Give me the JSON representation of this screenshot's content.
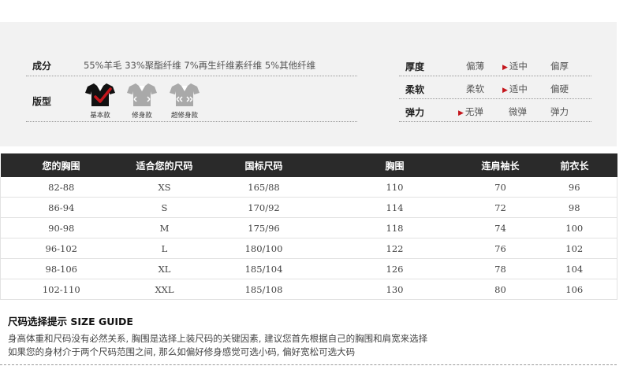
{
  "attributes": {
    "composition_label": "成分",
    "composition_value": "55%羊毛 33%聚酯纤维 7%再生纤维素纤维 5%其他纤维",
    "fit_label": "版型",
    "fits": [
      {
        "label": "基本款",
        "selected": true
      },
      {
        "label": "修身款",
        "selected": false
      },
      {
        "label": "超修身款",
        "selected": false
      }
    ],
    "thickness": {
      "label": "厚度",
      "options": [
        "偏薄",
        "适中",
        "偏厚"
      ],
      "selected": "适中"
    },
    "softness": {
      "label": "柔软",
      "options": [
        "柔软",
        "适中",
        "偏硬"
      ],
      "selected": "适中"
    },
    "elasticity": {
      "label": "弹力",
      "options": [
        "无弹",
        "微弹",
        "弹力"
      ],
      "selected": "无弹"
    }
  },
  "size_table": {
    "headers": [
      "您的胸围",
      "适合您的尺码",
      "国标尺码",
      "胸围",
      "连肩袖长",
      "前衣长"
    ],
    "rows": [
      [
        "82-88",
        "XS",
        "165/88",
        "110",
        "70",
        "96"
      ],
      [
        "86-94",
        "S",
        "170/92",
        "114",
        "72",
        "98"
      ],
      [
        "90-98",
        "M",
        "175/96",
        "118",
        "74",
        "100"
      ],
      [
        "96-102",
        "L",
        "180/100",
        "122",
        "76",
        "102"
      ],
      [
        "98-106",
        "XL",
        "185/104",
        "126",
        "78",
        "104"
      ],
      [
        "102-110",
        "XXL",
        "185/108",
        "130",
        "80",
        "106"
      ]
    ]
  },
  "guide": {
    "title": "尺码选择提示 SIZE GUIDE",
    "lines": [
      "身高体重和尺码没有必然关系, 胸围是选择上装尺码的关键因素, 建议您首先根据自己的胸围和肩宽来选择",
      "如果您的身材介于两个尺码范围之间, 那么如偏好修身感觉可选小码, 偏好宽松可选大码"
    ]
  },
  "colors": {
    "accent_red": "#c4161c",
    "header_bg": "#2a2a2a",
    "panel_bg": "#f2f2f2",
    "shirt_selected": "#111111",
    "shirt_unselected": "#a9a9a9"
  }
}
